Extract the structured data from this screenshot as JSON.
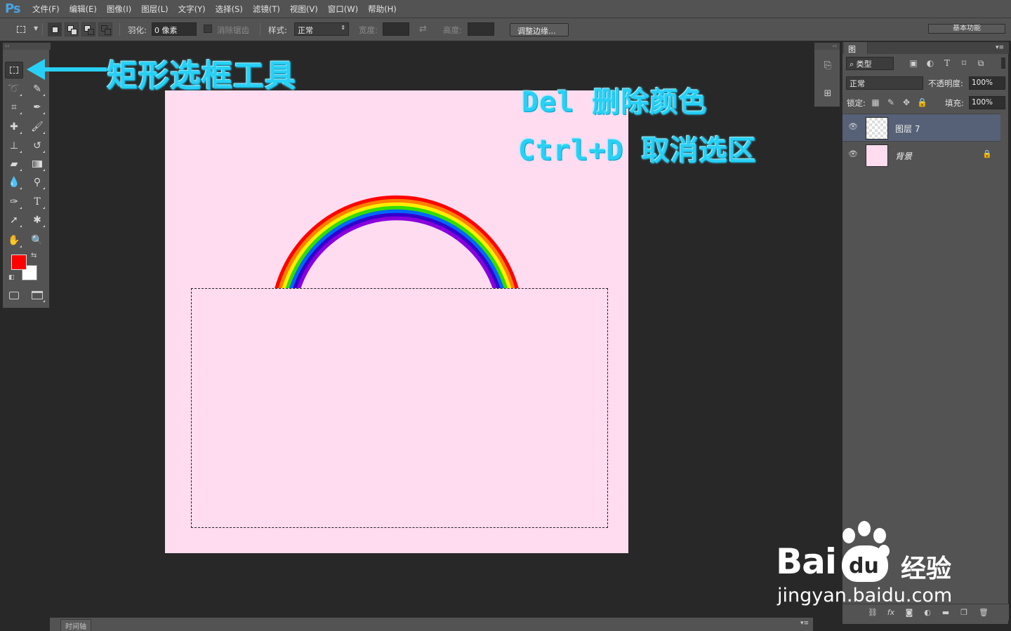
{
  "app": {
    "logo": "Ps"
  },
  "menu": [
    "文件(F)",
    "编辑(E)",
    "图像(I)",
    "图层(L)",
    "文字(Y)",
    "选择(S)",
    "滤镜(T)",
    "视图(V)",
    "窗口(W)",
    "帮助(H)"
  ],
  "options_bar": {
    "feather_label": "羽化:",
    "feather_value": "0 像素",
    "antialias_label": "消除锯齿",
    "style_label": "样式:",
    "style_value": "正常",
    "width_label": "宽度:",
    "height_label": "高度:",
    "refine_edge_button": "调整边缘...",
    "workspace": "基本功能"
  },
  "colors": {
    "foreground": "#ff0000",
    "background": "#ffffff",
    "canvas": "#ffdcf0",
    "annotation": "#29d0f5",
    "selected_layer": "#566177"
  },
  "annotations": {
    "tool_name": "矩形选框工具",
    "delete_hint": "Del 删除颜色",
    "deselect_hint": "Ctrl+D 取消选区"
  },
  "layers_panel": {
    "tab": "图层",
    "kind_filter": "类型",
    "blend_mode": "正常",
    "opacity_label": "不透明度:",
    "opacity_value": "100%",
    "lock_label": "锁定:",
    "fill_label": "填充:",
    "fill_value": "100%",
    "layers": [
      {
        "name": "图层 7",
        "selected": true
      },
      {
        "name": "背景",
        "selected": false,
        "locked": true
      }
    ]
  },
  "timeline": {
    "tab": "时间轴"
  },
  "watermark": {
    "brand": "Bai",
    "brand_cn": "经验",
    "url": "jingyan.baidu.com"
  },
  "rainbow": {
    "colors": [
      "#ff0000",
      "#ff7f00",
      "#ffee00",
      "#33dd00",
      "#0066ff",
      "#3300cc",
      "#8800dd"
    ]
  }
}
